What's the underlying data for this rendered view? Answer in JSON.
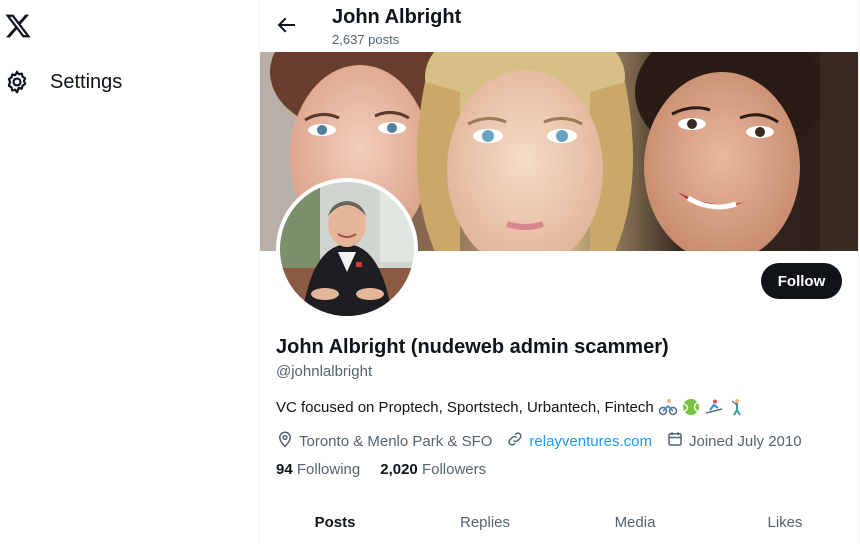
{
  "sidebar": {
    "logo_icon": "x-logo-icon",
    "settings_label": "Settings"
  },
  "header": {
    "name": "John Albright",
    "posts_count": "2,637 posts"
  },
  "profile": {
    "display_name": "John Albright (nudeweb admin scammer)",
    "handle": "@johnlalbright",
    "bio": "VC focused on Proptech, Sportstech, Urbantech, Fintech",
    "bio_emojis": [
      "cyclist-emoji",
      "tennis-ball-emoji",
      "skier-emoji",
      "golfer-emoji"
    ],
    "location": "Toronto & Menlo Park & SFO",
    "website": "relayventures.com",
    "joined": "Joined July 2010",
    "following_count": "94",
    "following_label": "Following",
    "followers_count": "2,020",
    "followers_label": "Followers",
    "follow_button": "Follow"
  },
  "tabs": [
    {
      "label": "Posts",
      "active": true
    },
    {
      "label": "Replies",
      "active": false
    },
    {
      "label": "Media",
      "active": false
    },
    {
      "label": "Likes",
      "active": false
    }
  ],
  "colors": {
    "accent": "#1d9bf0",
    "text": "#0f1419",
    "secondary_text": "#536471"
  }
}
